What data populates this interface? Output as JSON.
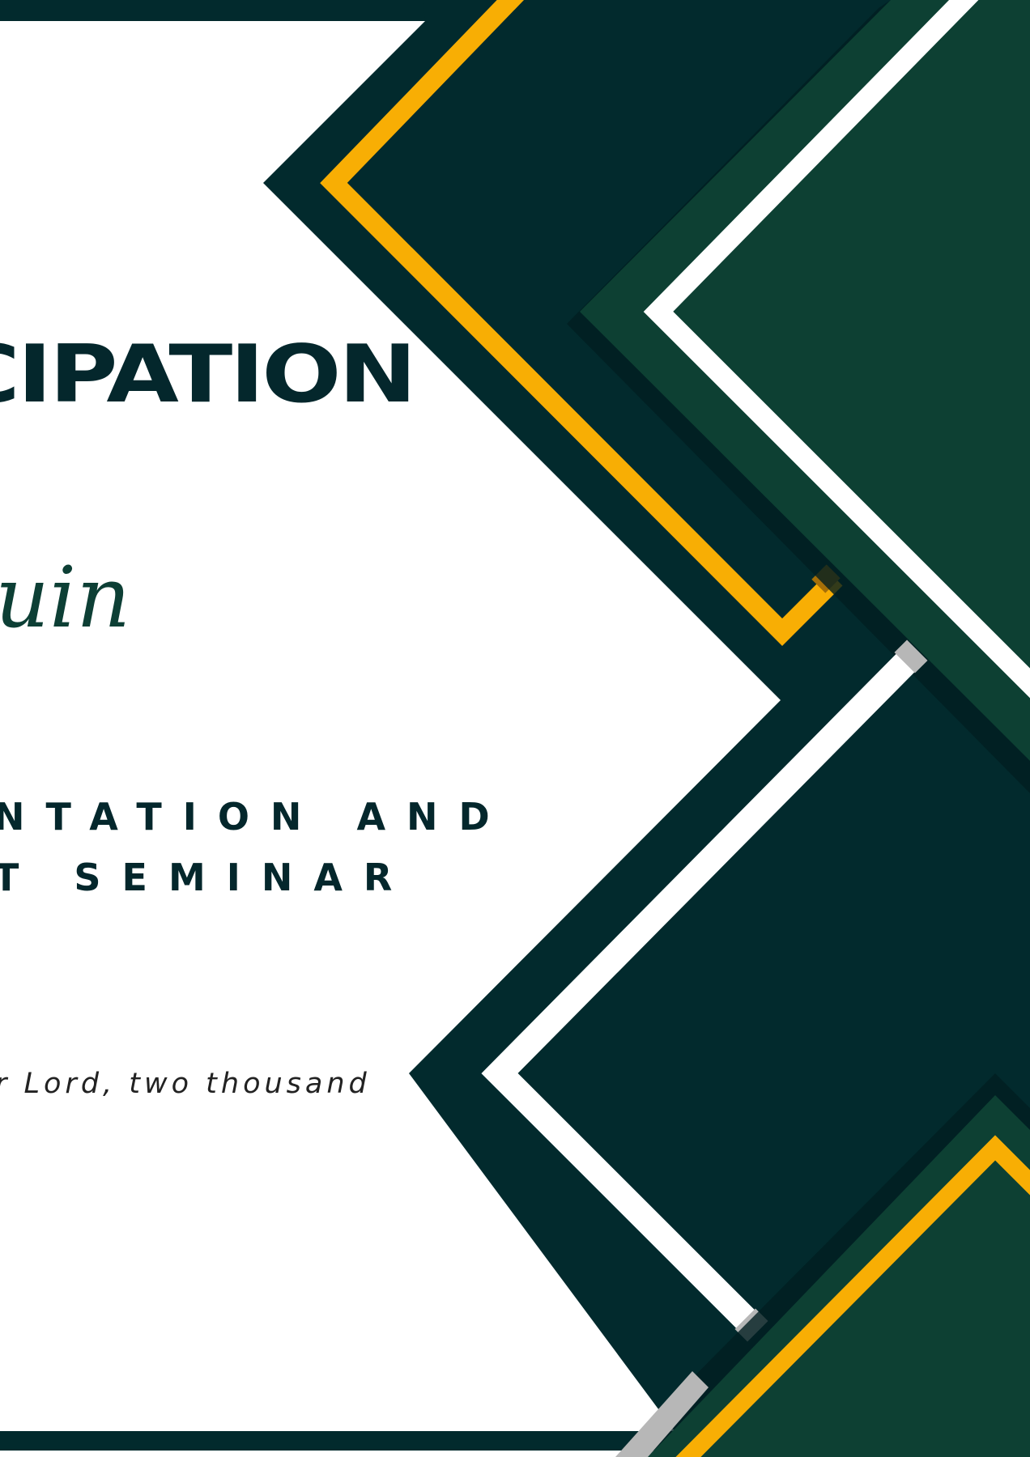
{
  "certificate": {
    "title": "CIPATION",
    "recipient_name": "uin",
    "event_line_1": "NTATION AND",
    "event_line_2": "T SEMINAR",
    "date_text": "r Lord, two thousand"
  },
  "colors": {
    "background": "#ffffff",
    "dark_teal": "#022a2d",
    "forest_green": "#0d4033",
    "gold": "#f8ae04",
    "white_stripe": "#ffffff",
    "text": "#04272c"
  }
}
